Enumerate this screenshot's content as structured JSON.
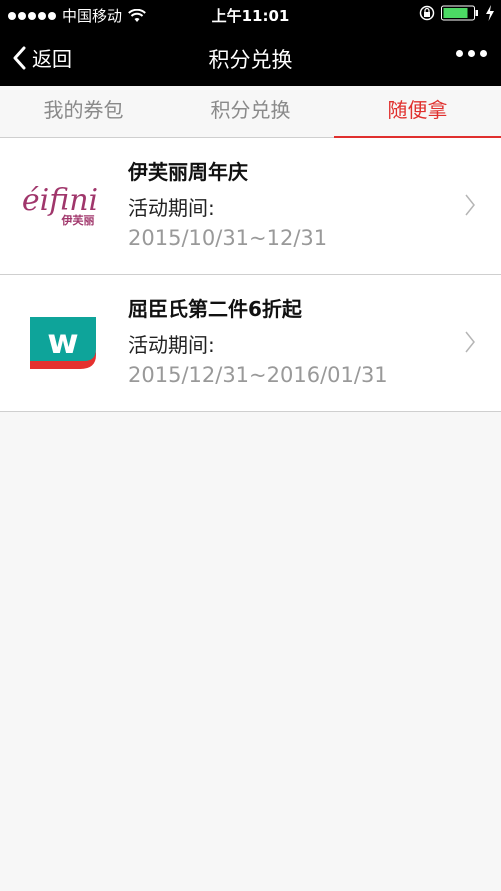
{
  "status_bar": {
    "carrier": "中国移动",
    "time": "上午11:01"
  },
  "nav": {
    "back_label": "返回",
    "title": "积分兑换"
  },
  "tabs": [
    {
      "label": "我的券包",
      "active": false
    },
    {
      "label": "积分兑换",
      "active": false
    },
    {
      "label": "随便拿",
      "active": true
    }
  ],
  "promos": [
    {
      "name": "伊芙丽周年庆",
      "period_label": "活动期间:",
      "dates": "2015/10/31~12/31",
      "logo": "eifini-logo",
      "logo_text": "éifini",
      "logo_subtext": "伊芙丽"
    },
    {
      "name": "屈臣氏第二件6折起",
      "period_label": "活动期间:",
      "dates": "2015/12/31~2016/01/31",
      "logo": "watsons-logo",
      "logo_text": "w"
    }
  ],
  "colors": {
    "accent": "#e0302e",
    "eifini_brand": "#a0366b",
    "watsons_teal": "#0ea49a",
    "watsons_red": "#e5312f"
  }
}
